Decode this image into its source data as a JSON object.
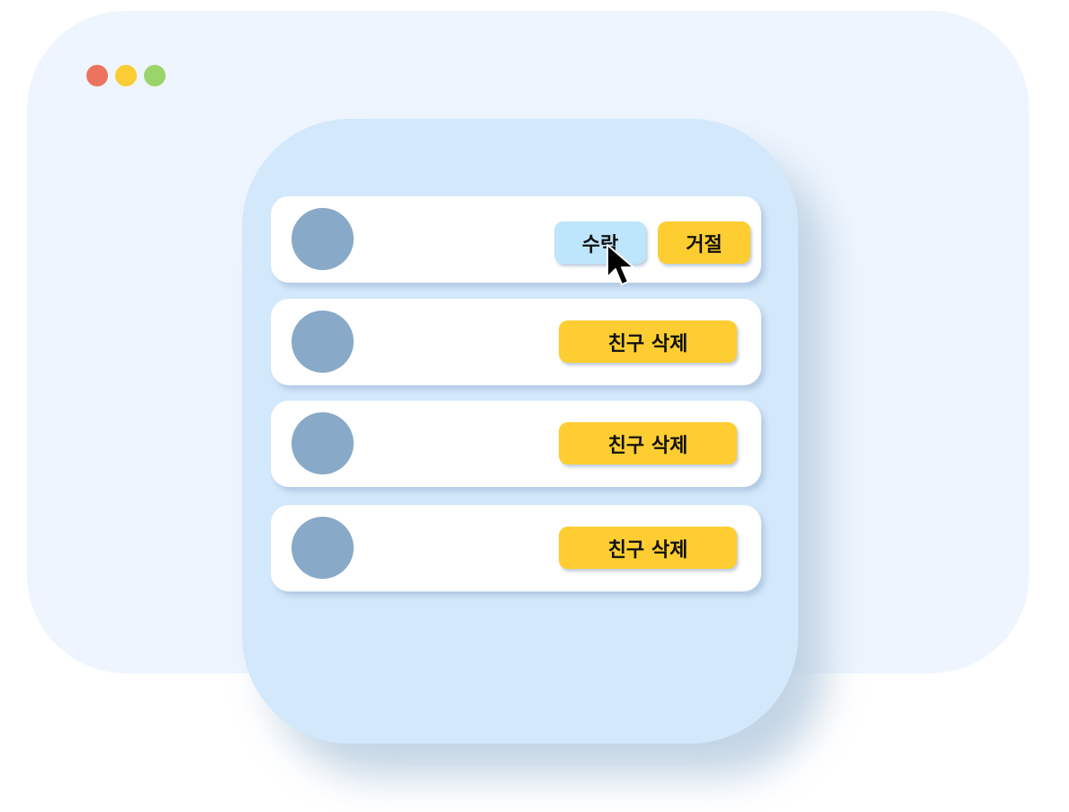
{
  "window": {
    "controls": [
      {
        "name": "close",
        "color": "#ec735e"
      },
      {
        "name": "minimize",
        "color": "#f9cd33"
      },
      {
        "name": "maximize",
        "color": "#9ad56b"
      }
    ]
  },
  "request_item": {
    "accept_label": "수락",
    "reject_label": "거절"
  },
  "friends": [
    {
      "delete_label": "친구 삭제"
    },
    {
      "delete_label": "친구 삭제"
    },
    {
      "delete_label": "친구 삭제"
    }
  ],
  "cursor": {
    "icon": "mouse-pointer-icon"
  }
}
